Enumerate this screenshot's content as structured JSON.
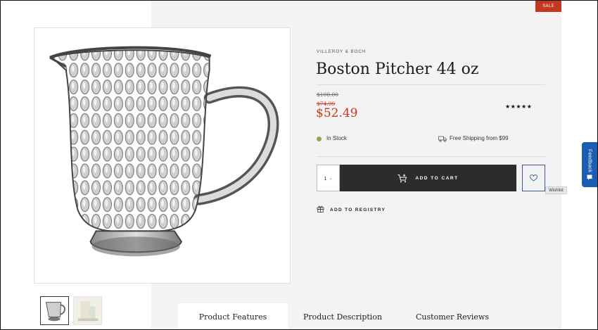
{
  "badge": {
    "sale": "SALE"
  },
  "product": {
    "brand": "VILLEROY & BOCH",
    "title": "Boston Pitcher 44 oz",
    "price_original": "$100.00",
    "price_was": "$74.99",
    "price_now": "$52.49",
    "rating_stars": "★★★★★"
  },
  "availability": {
    "stock": "In Stock",
    "shipping": "Free Shipping from $99"
  },
  "purchase": {
    "quantity": "1",
    "add_to_cart": "ADD TO CART",
    "wishlist_tooltip": "Wishlist",
    "add_to_registry": "ADD TO REGISTRY"
  },
  "tabs": [
    {
      "label": "Product Features"
    },
    {
      "label": "Product Description"
    },
    {
      "label": "Customer Reviews"
    }
  ],
  "feedback": {
    "label": "Feedback"
  },
  "colors": {
    "sale_red": "#c4391e",
    "in_stock_green": "#8fa75a",
    "button_dark": "#2c2c2c",
    "feedback_blue": "#1b5db2",
    "wishlist_border": "#3b5b8c"
  },
  "icons": [
    "pitcher-image",
    "truck-icon",
    "cart-plus-icon",
    "heart-icon",
    "gift-icon",
    "chevron-down-icon",
    "feedback-icon"
  ]
}
